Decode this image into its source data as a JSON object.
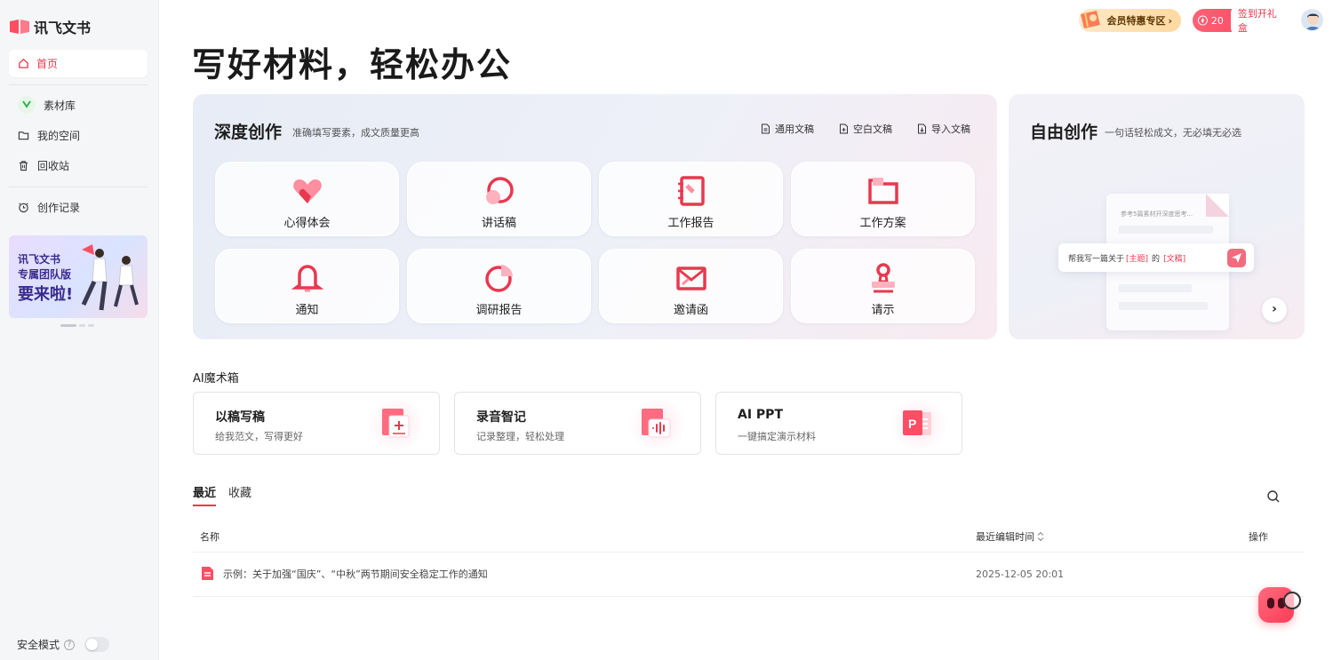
{
  "brand": {
    "name": "讯飞文书"
  },
  "sidebar": {
    "home": "首页",
    "items": [
      {
        "label": "素材库"
      },
      {
        "label": "我的空间"
      },
      {
        "label": "回收站"
      },
      {
        "label": "创作记录"
      }
    ],
    "banner": {
      "line1": "讯飞文书",
      "line2": "专属团队版",
      "line3": "要来啦!"
    },
    "safe_mode": "安全模式"
  },
  "topbar": {
    "vip": "会员特惠专区",
    "points": "20",
    "gift": "签到开礼盒"
  },
  "headline": "写好材料，轻松办公",
  "deep": {
    "title": "深度创作",
    "subtitle": "准确填写要素，成文质量更高",
    "actions": [
      "通用文稿",
      "空白文稿",
      "导入文稿"
    ],
    "tiles": [
      "心得体会",
      "讲话稿",
      "工作报告",
      "工作方案",
      "通知",
      "调研报告",
      "邀请函",
      "请示"
    ]
  },
  "free": {
    "title": "自由创作",
    "subtitle": "一句话轻松成文，无必填无必选",
    "doc_hint": "参考5篇素材开深度思考...",
    "prompt_pre": "帮我写一篇关于",
    "prompt_topic": "[主题]",
    "prompt_mid": "的",
    "prompt_doc": "[文稿]"
  },
  "ai_box": {
    "label": "AI魔术箱",
    "cards": [
      {
        "title": "以稿写稿",
        "desc": "给我范文，写得更好"
      },
      {
        "title": "录音智记",
        "desc": "记录整理，轻松处理"
      },
      {
        "title": "AI PPT",
        "desc": "一键搞定演示材料"
      }
    ]
  },
  "list": {
    "tabs": [
      "最近",
      "收藏"
    ],
    "columns": {
      "name": "名称",
      "time": "最近编辑时间",
      "ops": "操作"
    },
    "rows": [
      {
        "name": "示例：关于加强“国庆”、“中秋”两节期间安全稳定工作的通知",
        "time": "2025-12-05 20:01"
      }
    ]
  },
  "colors": {
    "accent": "#e8384f",
    "sidebar_bg": "#f5f6f8"
  }
}
